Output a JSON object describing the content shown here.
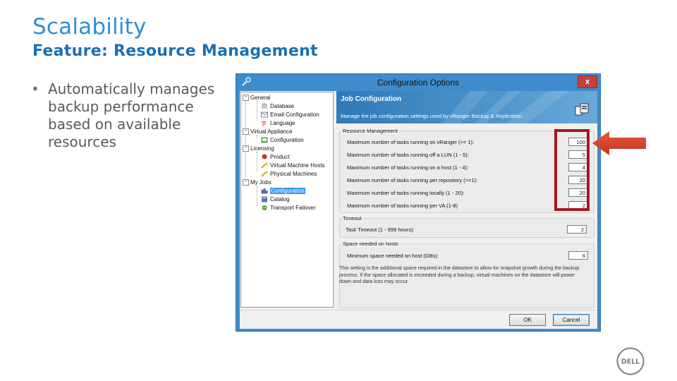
{
  "slide": {
    "title": "Scalability",
    "subtitle": "Feature: Resource Management",
    "bullet": "Automatically manages backup performance based on available resources",
    "accent_color": "#2f8fd4",
    "highlight_color": "#a11a1d",
    "arrow_color": "#d9432a"
  },
  "dialog": {
    "title": "Configuration Options",
    "close_label": "x",
    "tree": {
      "general": "General",
      "database": "Database",
      "email": "Email Configuration",
      "language": "Language",
      "virtual_appliance": "Virtual Appliance",
      "va_config": "Configuration",
      "licensing": "Licensing",
      "product": "Product",
      "vm_hosts": "Virtual Machine Hosts",
      "physical": "Physical Machines",
      "my_jobs": "My Jobs",
      "jobs_config": "Configuration",
      "catalog": "Catalog",
      "transport": "Transport Failover"
    },
    "panel": {
      "title": "Job Configuration",
      "description": "Manage the job configuration settings used by vRanger Backup & Replication."
    },
    "resource": {
      "group_title": "Resource Management",
      "rows": [
        {
          "label": "Maximum number of tasks running on vRanger (>= 1):",
          "value": "100"
        },
        {
          "label": "Maximum number of tasks running off a LUN (1 - 5):",
          "value": "5"
        },
        {
          "label": "Maximum number of tasks running on a host (1 - 4):",
          "value": "4"
        },
        {
          "label": "Maximum number of tasks running per repository (>=1):",
          "value": "20"
        },
        {
          "label": "Maximum number of tasks running locally (1 - 20):",
          "value": "20"
        },
        {
          "label": "Maximum number of tasks running per VA (1-8)",
          "value": "2"
        }
      ]
    },
    "timeout": {
      "group_title": "Timeout",
      "label": "Task Timeout (1 - 999 hours):",
      "value": "2"
    },
    "space": {
      "group_title": "Space needed on hosts",
      "label": "Minimum space needed on host (GBs):",
      "value": "6",
      "note": "This setting is the additional space required in the datastore to allow for snapshot growth during the backup process. If the space allocated is exceeded during a backup, virtual machines on the datastore will power down and data loss may occur."
    },
    "buttons": {
      "ok": "OK",
      "cancel": "Cancel"
    }
  },
  "logo": {
    "text": "DELL"
  }
}
